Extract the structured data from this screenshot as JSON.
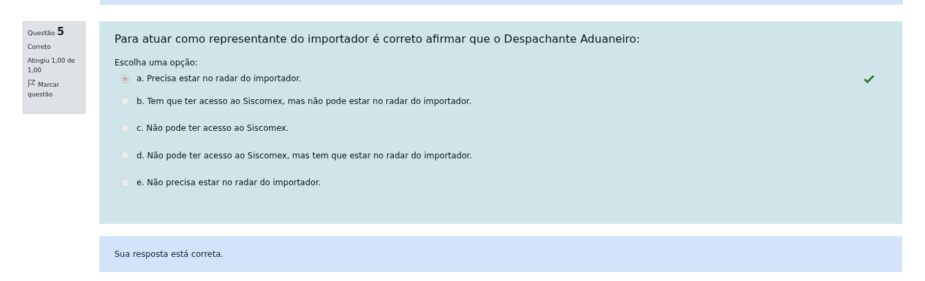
{
  "question": {
    "label": "Questão",
    "number": "5",
    "state": "Correto",
    "grade": "Atingiu 1,00 de 1,00",
    "flag": "Marcar questão"
  },
  "prompt": "Para atuar como representante do importador é correto afirmar que o Despachante Aduaneiro:",
  "instruction": "Escolha uma opção:",
  "options": [
    {
      "text": "a. Precisa estar no radar do importador.",
      "selected": true,
      "correct": true
    },
    {
      "text": "b. Tem que ter acesso ao Siscomex, mas não pode estar no radar do importador.",
      "selected": false,
      "correct": false
    },
    {
      "text": "c. Não pode ter acesso ao Siscomex.",
      "selected": false,
      "correct": false
    },
    {
      "text": "d. Não pode ter acesso ao Siscomex, mas tem que estar no radar do importador.",
      "selected": false,
      "correct": false
    },
    {
      "text": "e. Não precisa estar no radar do importador.",
      "selected": false,
      "correct": false
    }
  ],
  "feedback": "Sua resposta está correta."
}
